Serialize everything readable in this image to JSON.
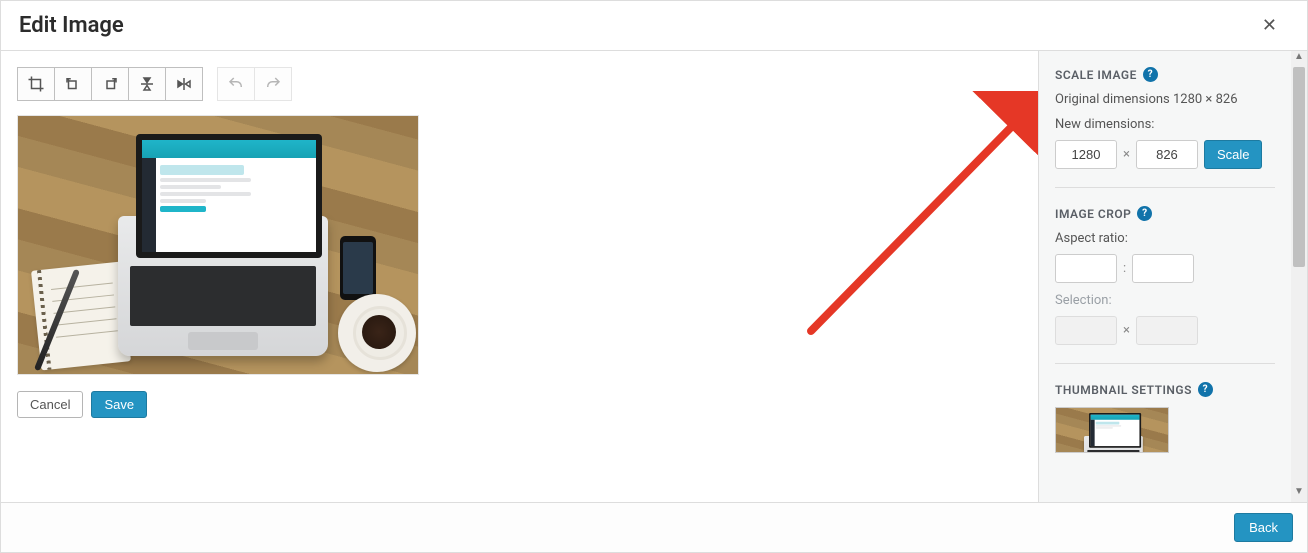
{
  "title": "Edit Image",
  "toolbar": {
    "crop": "crop",
    "rotate_left": "rotate-left",
    "rotate_right": "rotate-right",
    "flip_vertical": "flip-vertical",
    "flip_horizontal": "flip-horizontal",
    "undo": "undo",
    "redo": "redo"
  },
  "buttons": {
    "cancel": "Cancel",
    "save": "Save",
    "back": "Back"
  },
  "sidebar": {
    "scale": {
      "title": "SCALE IMAGE",
      "original_label": "Original dimensions 1280 × 826",
      "new_label": "New dimensions:",
      "width": "1280",
      "height": "826",
      "separator": "×",
      "button": "Scale"
    },
    "crop": {
      "title": "IMAGE CROP",
      "aspect_label": "Aspect ratio:",
      "aspect_sep": ":",
      "selection_label": "Selection:",
      "selection_sep": "×"
    },
    "thumb": {
      "title": "THUMBNAIL SETTINGS"
    }
  },
  "help_glyph": "?"
}
